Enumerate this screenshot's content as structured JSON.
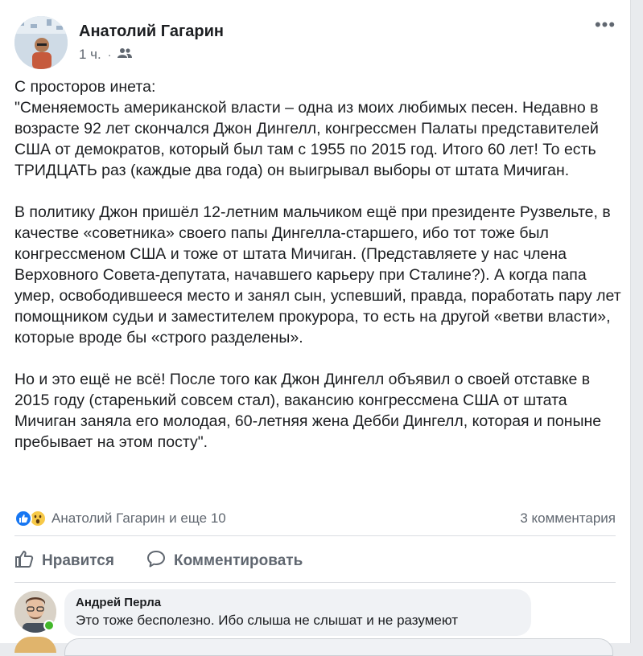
{
  "post": {
    "author": "Анатолий Гагарин",
    "time": "1 ч.",
    "privacy_icon": "friends-icon",
    "more_label": "•••",
    "paragraphs": [
      "С просторов инета:\n\"Сменяемость американской власти – одна из моих любимых песен. Недавно в возрасте 92 лет скончался Джон Дингелл, конгрессмен Палаты представителей США от демократов, который был там с 1955 по 2015 год. Итого 60 лет! То есть ТРИДЦАТЬ раз (каждые два года) он выигрывал выборы от штата Мичиган.",
      "В политику Джон пришёл 12-летним мальчиком ещё при президенте Рузвельте, в качестве «советника» своего папы Дингелла-старшего, ибо тот тоже был конгрессменом США и тоже от штата Мичиган. (Представляете у нас члена Верховного Совета-депутата, начавшего карьеру при Сталине?). А когда папа умер, освободившееся место и занял сын, успевший, правда, поработать пару лет помощником судьи и заместителем прокурора, то есть на другой «ветви власти», которые вроде бы «строго разделены».",
      "Но и это ещё не всё! После того как Джон Дингелл объявил о своей отставке в 2015 году (старенький совсем стал), вакансию конгрессмена США от штата Мичиган заняла его молодая, 60-летняя жена Дебби Дингелл, которая и поныне пребывает на этом посту\"."
    ]
  },
  "reactions": {
    "summary": "Анатолий Гагарин и еще 10",
    "comments_count": "3 комментария",
    "icons": [
      "like-icon",
      "wow-icon"
    ]
  },
  "actions": {
    "like_label": "Нравится",
    "comment_label": "Комментировать"
  },
  "comment": {
    "author": "Андрей Перла",
    "text": "Это тоже бесполезно. Ибо слыша не слышат и не разумеют"
  },
  "colors": {
    "accent": "#1877f2",
    "muted": "#606770",
    "bubble": "#f0f2f5"
  }
}
